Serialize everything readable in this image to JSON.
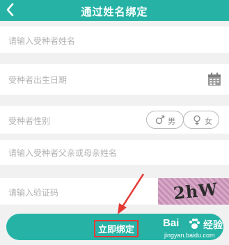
{
  "header": {
    "title": "通过姓名绑定",
    "back_icon": "chevron-left-icon"
  },
  "form": {
    "recipient_name_placeholder": "请输入受种者姓名",
    "birth_date_placeholder": "受种者出生日期",
    "gender_label": "受种者性别",
    "gender_male": "男",
    "gender_female": "女",
    "parent_name_placeholder": "请输入受种者父亲或母亲姓名",
    "captcha_placeholder": "请输入验证码",
    "captcha_text": "2hW"
  },
  "submit": {
    "label": "立即绑定"
  },
  "watermark": {
    "brand": "Bai",
    "experience": "经验",
    "url": "jingyan.baidu.com"
  },
  "colors": {
    "primary": "#26b3a6",
    "highlight": "#e53935"
  }
}
